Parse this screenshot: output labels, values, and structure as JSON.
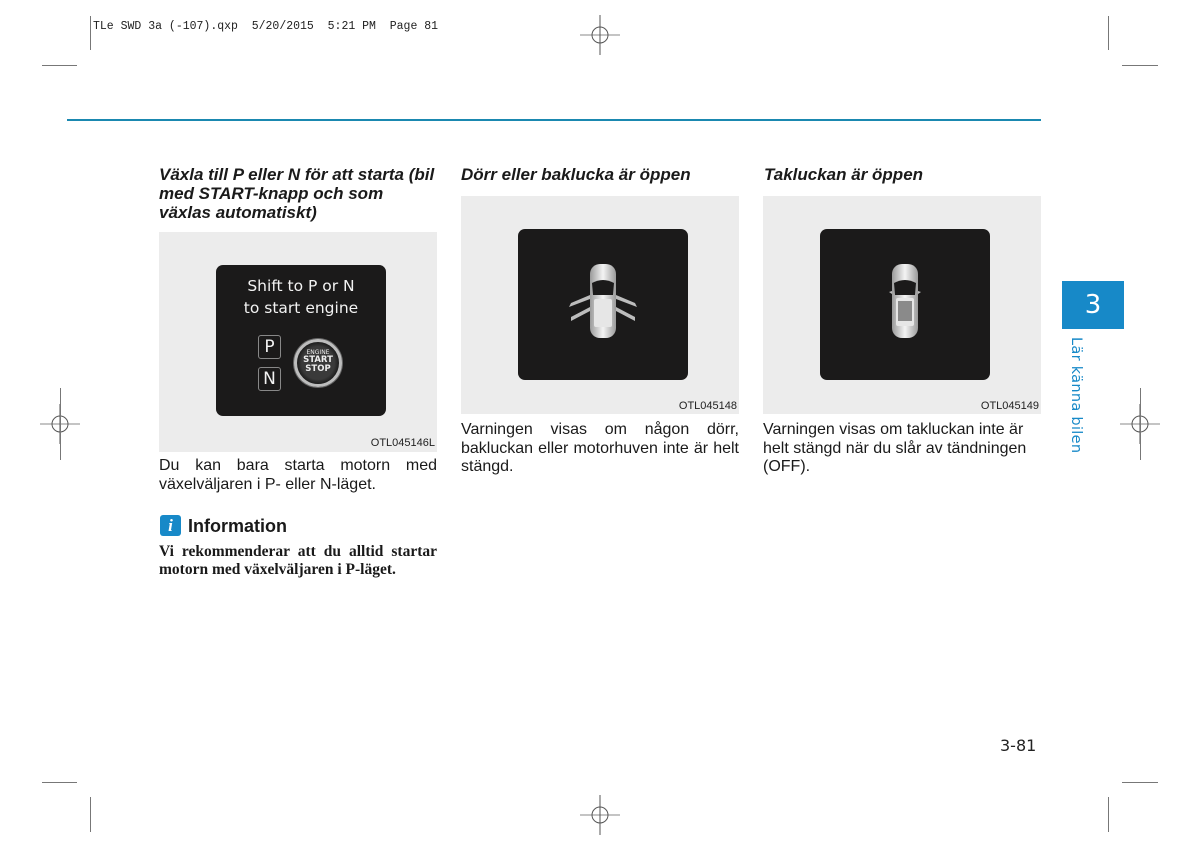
{
  "print_slug": "TLe SWD 3a (-107).qxp  5/20/2015  5:21 PM  Page 81",
  "accent_color": "#1789c8",
  "columns": [
    {
      "heading": "Växla till P eller N för att starta (bil med START-knapp och som växlas automatiskt)",
      "figure": {
        "display_line1": "Shift to P or N",
        "display_line2": "to start engine",
        "gear_p": "P",
        "gear_n": "N",
        "button_line1": "ENGINE",
        "button_line2": "START",
        "button_line3": "STOP",
        "code": "OTL045146L"
      },
      "body": "Du kan bara starta motorn med växelväljaren i P- eller N-läget.",
      "info": {
        "icon": "info-icon",
        "title": "Information",
        "text": "Vi rekommenderar att du alltid startar motorn med växelväljaren i P-läget."
      }
    },
    {
      "heading": "Dörr eller baklucka är öppen",
      "figure": {
        "icon": "car-doors-open-icon",
        "code": "OTL045148"
      },
      "body": "Varningen visas om någon dörr, bakluckan eller motorhuven inte är helt stängd."
    },
    {
      "heading": "Takluckan är öppen",
      "figure": {
        "icon": "car-sunroof-open-icon",
        "code": "OTL045149"
      },
      "body": "Varningen visas om takluckan inte är helt stängd när du slår av tändningen (OFF)."
    }
  ],
  "chapter_tab": {
    "number": "3",
    "title": "Lär känna bilen"
  },
  "page_number": "3-81"
}
